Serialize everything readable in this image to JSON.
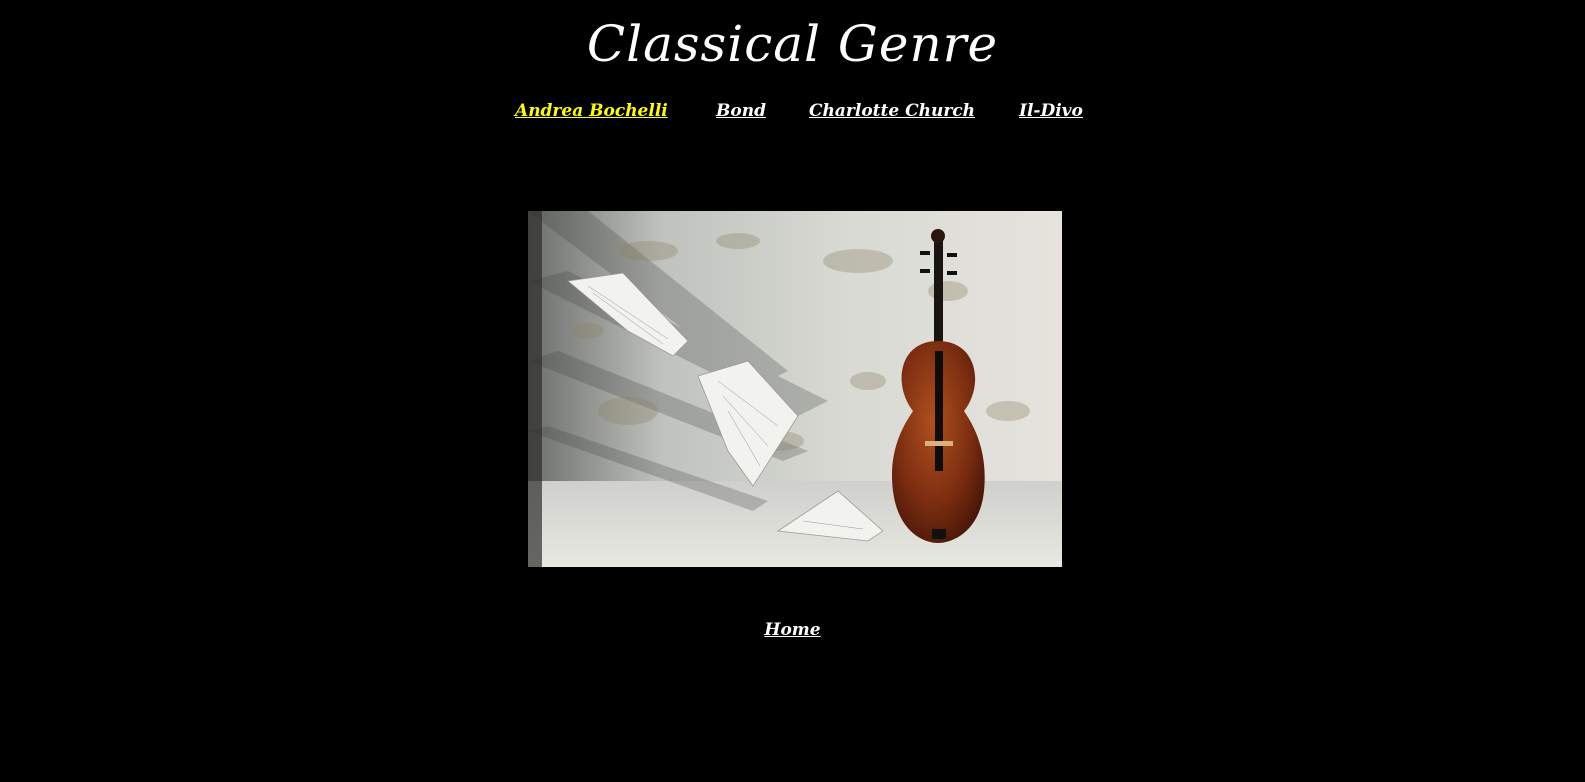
{
  "header": {
    "title": "Classical Genre"
  },
  "nav": {
    "items": [
      {
        "label": "Andrea Bochelli",
        "active": true
      },
      {
        "label": "Bond",
        "active": false
      },
      {
        "label": "Charlotte Church",
        "active": false
      },
      {
        "label": "Il-Divo",
        "active": false
      }
    ]
  },
  "hero": {
    "image": "violin-with-flying-sheet-music"
  },
  "footer": {
    "home_label": "Home"
  },
  "colors": {
    "background": "#000000",
    "text": "#ffffff",
    "active_link": "#ffff00"
  }
}
